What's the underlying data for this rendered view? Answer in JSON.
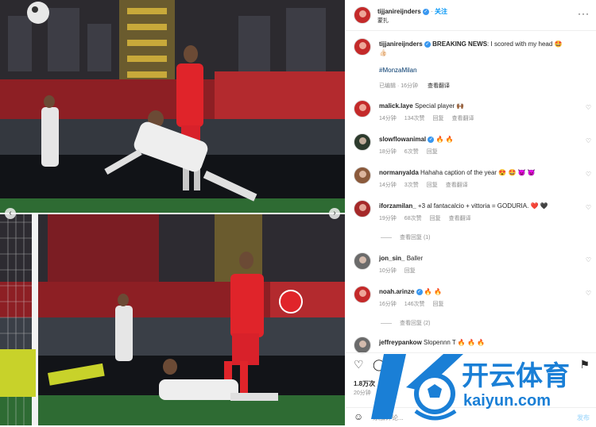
{
  "post": {
    "author": "tijjanireijnders",
    "follow_label": "关注",
    "location": "蒙扎",
    "caption_author": "tijjanireijnders",
    "caption_bold": "BREAKING NEWS",
    "caption_rest": ": I scored with my head 🤩",
    "caption_extra": "👍🏻",
    "hashtag": "#MonzaMilan",
    "edited": "已编辑 · 16分钟",
    "see_translation": "查看翻译"
  },
  "comments": [
    {
      "user": "malick.laye",
      "verified": false,
      "text": "Special player 🙌🏾",
      "time": "14分钟",
      "likes": "134次赞",
      "reply": "回复",
      "translate": "查看翻译",
      "avatar": "red"
    },
    {
      "user": "slowflowanimal",
      "verified": true,
      "text": "🔥 🔥",
      "time": "18分钟",
      "likes": "6次赞",
      "reply": "回复",
      "translate": "",
      "avatar": "dark"
    },
    {
      "user": "normanyalda",
      "verified": false,
      "text": "Hahaha caption of the year 😍 🤩 😈 😈",
      "time": "14分钟",
      "likes": "3次赞",
      "reply": "回复",
      "translate": "查看翻译",
      "avatar": "brown"
    },
    {
      "user": "iforzamilan_",
      "verified": false,
      "text": "+3 al fantacalcio + vittoria = GODURIA. ❤️ 🖤",
      "time": "19分钟",
      "likes": "68次赞",
      "reply": "回复",
      "translate": "查看翻译",
      "avatar": "red2",
      "replies": "查看回复 (1)"
    },
    {
      "user": "jon_sin_",
      "verified": false,
      "text": "Baller",
      "time": "10分钟",
      "likes": "",
      "reply": "回复",
      "translate": "",
      "avatar": "grey"
    },
    {
      "user": "noah.arinze",
      "verified": true,
      "text": "🔥 🔥",
      "time": "16分钟",
      "likes": "146次赞",
      "reply": "回复",
      "translate": "",
      "avatar": "red",
      "replies": "查看回复 (2)"
    },
    {
      "user": "jeffreypankow",
      "verified": false,
      "text": "Slopennn T 🔥 🔥 🔥",
      "time": "",
      "likes": "",
      "reply": "",
      "translate": "",
      "avatar": "grey"
    }
  ],
  "footer": {
    "likes": "1.8万次",
    "time": "20分钟",
    "add_comment_placeholder": "添加评论...",
    "post_label": "发布"
  },
  "watermark": {
    "brand_cn": "开云体育",
    "brand_url": "kaiyun.com"
  },
  "colors": {
    "accent": "#0095f6",
    "milan_red": "#e0242a",
    "watermark_blue": "#1a7fd6"
  }
}
